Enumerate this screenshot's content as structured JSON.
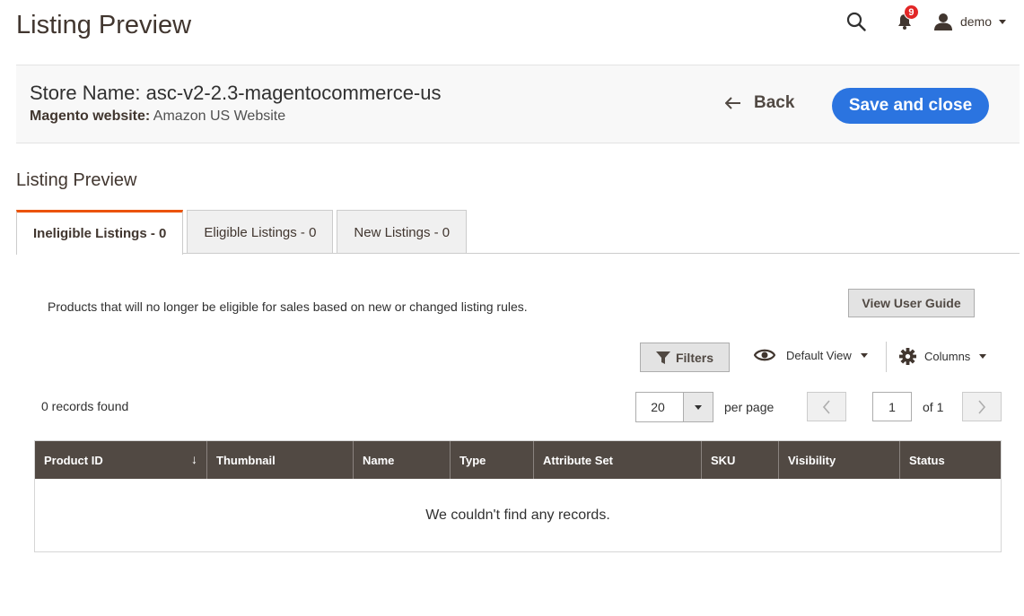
{
  "header": {
    "title": "Listing Preview",
    "notification_count": "9",
    "user_name": "demo"
  },
  "store": {
    "name": "Store Name: asc-v2-2.3-magentocommerce-us",
    "website_label": "Magento website:",
    "website_value": "Amazon US Website",
    "back_label": "Back",
    "save_label": "Save and close"
  },
  "section_title": "Listing Preview",
  "tabs": [
    {
      "label": "Ineligible Listings - 0",
      "active": true
    },
    {
      "label": "Eligible Listings - 0",
      "active": false
    },
    {
      "label": "New Listings - 0",
      "active": false
    }
  ],
  "description": "Products that will no longer be eligible for sales based on new or changed listing rules.",
  "guide_label": "View User Guide",
  "toolbar": {
    "filters_label": "Filters",
    "view_label": "Default View",
    "columns_label": "Columns"
  },
  "pager": {
    "records_text": "0 records found",
    "per_page_value": "20",
    "per_page_label": "per page",
    "current_page": "1",
    "of_text": "of 1"
  },
  "grid": {
    "columns": [
      "Product ID",
      "Thumbnail",
      "Name",
      "Type",
      "Attribute Set",
      "SKU",
      "Visibility",
      "Status"
    ],
    "sort_arrow": "↓",
    "empty_text": "We couldn't find any records."
  },
  "colors": {
    "primary_button": "#2b74e0",
    "grid_header": "#514943",
    "active_tab_accent": "#eb5202",
    "badge": "#e22626"
  }
}
